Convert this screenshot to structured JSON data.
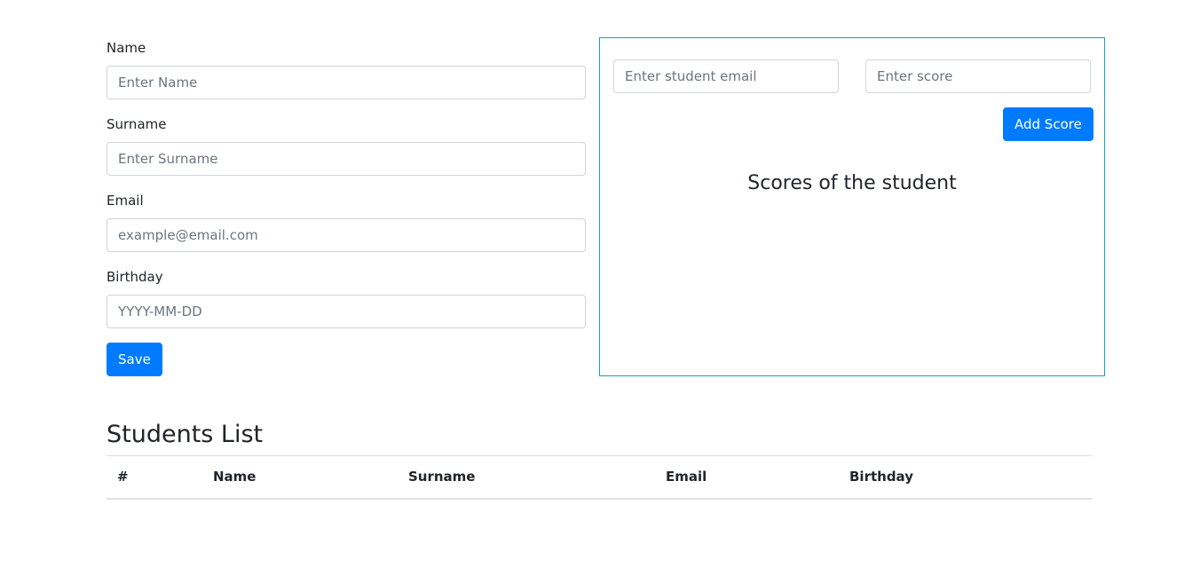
{
  "student_form": {
    "name_label": "Name",
    "name_placeholder": "Enter Name",
    "surname_label": "Surname",
    "surname_placeholder": "Enter Surname",
    "email_label": "Email",
    "email_placeholder": "example@email.com",
    "birthday_label": "Birthday",
    "birthday_placeholder": "YYYY-MM-DD",
    "save_label": "Save"
  },
  "scores_panel": {
    "email_placeholder": "Enter student email",
    "score_placeholder": "Enter score",
    "add_score_label": "Add Score",
    "title": "Scores of the student",
    "border_color": "#17a2b8"
  },
  "students_list": {
    "title": "Students List",
    "columns": [
      "#",
      "Name",
      "Surname",
      "Email",
      "Birthday"
    ]
  },
  "colors": {
    "primary": "#007bff"
  }
}
